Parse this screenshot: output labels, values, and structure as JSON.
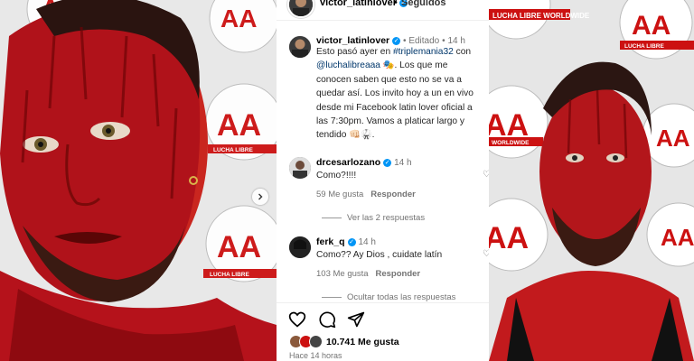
{
  "post": {
    "username": "victor_latinlover",
    "following_label": "Seguidos",
    "edited_label": "Editado",
    "time_ago": "14 h",
    "caption": {
      "part1": "Esto pasó ayer en ",
      "hashtag": "#triplemania32",
      "part2": " con ",
      "mention": "@luchalibreaaa",
      "part3": " 🎭. Los que me conocen saben que esto no se va a quedar así. Los invito hoy a un en vivo desde mi Facebook latin lover oficial a las 7:30pm. Vamos a platicar largo y tendido 👊🏻🥋."
    }
  },
  "comments": [
    {
      "username": "drcesarlozano",
      "time": "14 h",
      "text": "Como?!!!!",
      "likes": "59 Me gusta",
      "reply_label": "Responder",
      "replies_label": "Ver las 2 respuestas"
    },
    {
      "username": "ferk_q",
      "time": "14 h",
      "text": "Como?? Ay Dios , cuidate latín",
      "likes": "103 Me gusta",
      "reply_label": "Responder",
      "replies_label": "Ocultar todas las respuestas"
    }
  ],
  "footer": {
    "likes": "10.741 Me gusta",
    "time": "Hace 14 horas"
  },
  "photo_banner": {
    "brand": "LUCHA LIBRE",
    "brand2": "LUCHA LIBRE WORLDWIDE",
    "brand3": "WORLDWIDE"
  },
  "colors": {
    "blood": "#a0070b",
    "link": "#00376b",
    "verified": "#0095f6",
    "muted": "#737373"
  }
}
